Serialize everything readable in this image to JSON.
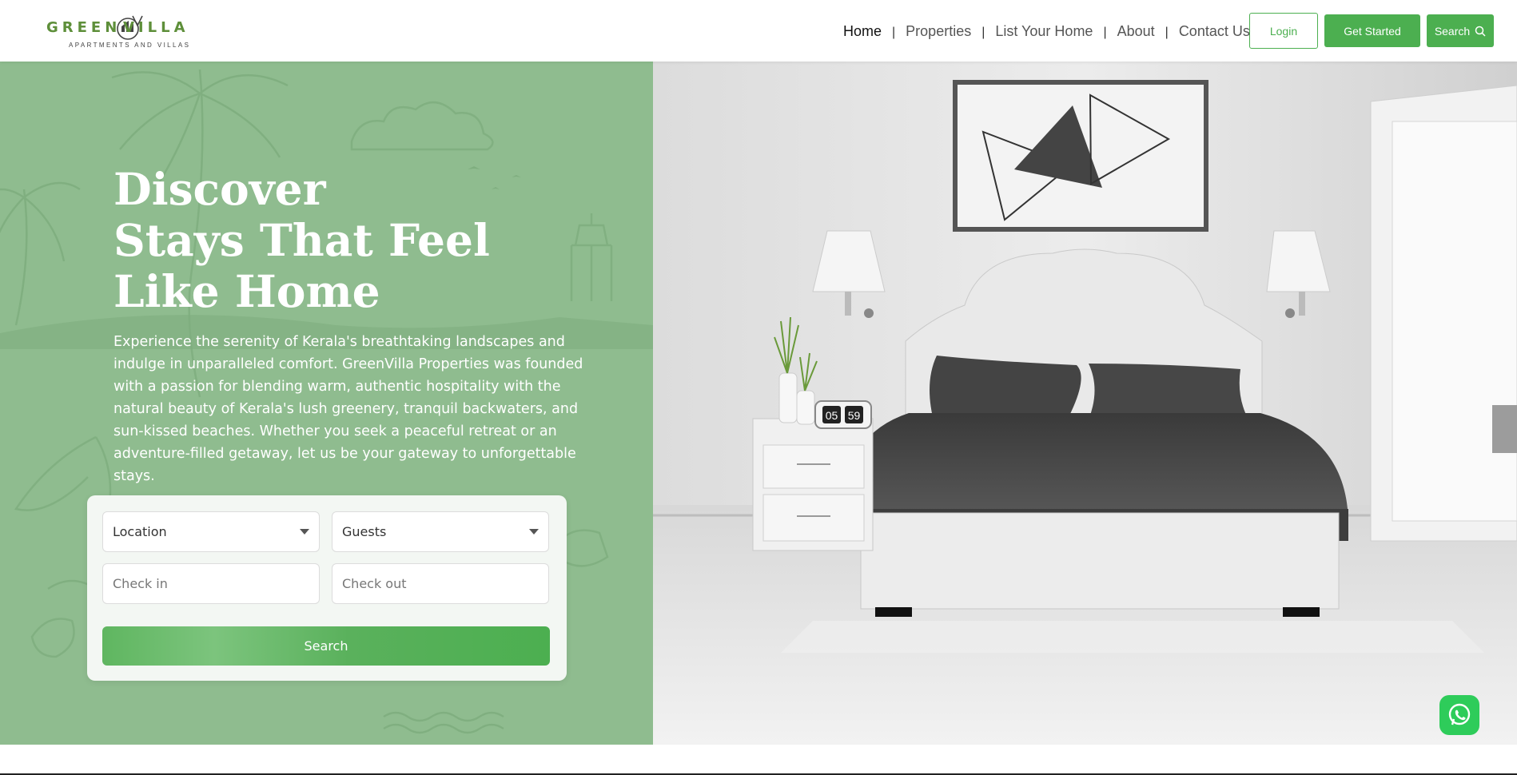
{
  "brand": {
    "name_left": "GREEN",
    "name_right": "VILLA",
    "tagline": "APARTMENTS AND VILLAS",
    "logo_icon": "house-circle-icon",
    "color": "#5e8f3a"
  },
  "nav": {
    "items": [
      {
        "label": "Home",
        "active": true
      },
      {
        "label": "Properties",
        "active": false
      },
      {
        "label": "List Your Home",
        "active": false
      },
      {
        "label": "About",
        "active": false
      },
      {
        "label": "Contact Us",
        "active": false
      }
    ],
    "separator": "|",
    "login_label": "Login",
    "get_started_label": "Get Started",
    "search_label": "Search",
    "search_icon": "search-icon"
  },
  "hero": {
    "title_lines": [
      "Discover",
      "Stays That Feel",
      "Like Home"
    ],
    "description": "Experience the serenity of Kerala's breathtaking landscapes and indulge in unparalleled comfort. GreenVilla Properties was founded with a passion for blending warm, authentic hospitality with the natural beauty of Kerala's lush greenery, tranquil backwaters, and sun-kissed beaches. Whether you seek a peaceful retreat or an adventure-filled getaway, let us be your gateway to unforgettable stays.",
    "background_color": "#8fbc8f"
  },
  "search_form": {
    "location": {
      "selected": "Location"
    },
    "guests": {
      "selected": "Guests"
    },
    "check_in": {
      "placeholder": "Check in"
    },
    "check_out": {
      "placeholder": "Check out"
    },
    "submit_label": "Search"
  },
  "illustration": {
    "clock": {
      "hours": "05",
      "minutes": "59"
    }
  },
  "floating": {
    "whatsapp_icon": "whatsapp-icon"
  },
  "colors": {
    "accent": "#4caf50",
    "hero_green": "#8fbc8f"
  }
}
